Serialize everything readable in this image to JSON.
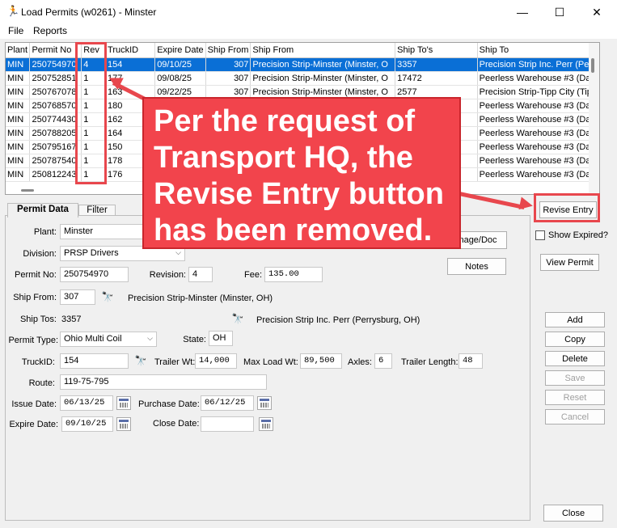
{
  "window": {
    "title": "Load Permits (w0261) - Minster",
    "minimize": "—",
    "maximize": "☐",
    "close": "✕"
  },
  "menu": [
    "File",
    "Reports"
  ],
  "grid": {
    "columns": [
      "Plant",
      "Permit No",
      "Rev",
      "TruckID",
      "Expire Date",
      "Ship From",
      "Ship From",
      "Ship To's",
      "Ship To"
    ],
    "rows": [
      [
        "MIN",
        "250754970",
        "4",
        "154",
        "09/10/25",
        "307",
        "Precision Strip-Minster (Minster, O",
        "3357",
        "Precision Strip Inc. Perr (Perr"
      ],
      [
        "MIN",
        "250752851",
        "1",
        "177",
        "09/08/25",
        "307",
        "Precision Strip-Minster (Minster, O",
        "17472",
        "Peerless Warehouse #3 (Day"
      ],
      [
        "MIN",
        "250767078",
        "1",
        "163",
        "09/22/25",
        "307",
        "Precision Strip-Minster (Minster, O",
        "2577",
        "Precision Strip-Tipp City (Tipp"
      ],
      [
        "MIN",
        "250768570",
        "1",
        "180",
        "",
        "",
        "",
        "",
        "Peerless Warehouse #3 (Day"
      ],
      [
        "MIN",
        "250774430",
        "1",
        "162",
        "",
        "",
        "",
        "",
        "Peerless Warehouse #3 (Day"
      ],
      [
        "MIN",
        "250788205",
        "1",
        "164",
        "",
        "",
        "",
        "",
        "Peerless Warehouse #3 (Day"
      ],
      [
        "MIN",
        "250795167",
        "1",
        "150",
        "",
        "",
        "",
        "",
        "Peerless Warehouse #3 (Day"
      ],
      [
        "MIN",
        "250787540",
        "1",
        "178",
        "",
        "",
        "",
        "",
        "Peerless Warehouse #3 (Day"
      ],
      [
        "MIN",
        "250812243",
        "1",
        "176",
        "",
        "",
        "",
        "",
        "Peerless Warehouse #3 (Day"
      ]
    ]
  },
  "tabs": [
    "Permit Data",
    "Filter"
  ],
  "form": {
    "plant_label": "Plant:",
    "plant": "Minster",
    "division_label": "Division:",
    "division": "PRSP Drivers",
    "permit_no_label": "Permit No:",
    "permit_no": "250754970",
    "revision_label": "Revision:",
    "revision": "4",
    "fee_label": "Fee:",
    "fee": "135.00",
    "ship_from_label": "Ship From:",
    "ship_from": "307",
    "ship_from_name": "Precision Strip-Minster (Minster, OH)",
    "ship_tos_label": "Ship Tos:",
    "ship_tos": "3357",
    "ship_to_name": "Precision Strip Inc. Perr (Perrysburg, OH)",
    "permit_type_label": "Permit Type:",
    "permit_type": "Ohio Multi Coil",
    "state_label": "State:",
    "state": "OH",
    "truck_label": "TruckID:",
    "truck": "154",
    "trailer_wt_label": "Trailer Wt:",
    "trailer_wt": "14,000",
    "max_load_label": "Max Load Wt:",
    "max_load": "89,500",
    "axles_label": "Axles:",
    "axles": "6",
    "trailer_len_label": "Trailer Length:",
    "trailer_len": "48",
    "route_label": "Route:",
    "route": "119-75-795",
    "issue_label": "Issue Date:",
    "issue": "06/13/25",
    "purchase_label": "Purchase Date:",
    "purchase": "06/12/25",
    "expire_label": "Expire Date:",
    "expire": "09/10/25",
    "close_date_label": "Close Date:",
    "close_date": ""
  },
  "buttons": {
    "image_doc": "nage/Doc",
    "notes": "Notes",
    "revise_entry": "Revise Entry",
    "show_expired": "Show Expired?",
    "view_permit": "View Permit",
    "add": "Add",
    "copy": "Copy",
    "delete": "Delete",
    "save": "Save",
    "reset": "Reset",
    "cancel": "Cancel",
    "close": "Close"
  },
  "callout": {
    "lines": [
      "Per the request of",
      "Transport HQ, the",
      "Revise Entry button",
      "has been removed."
    ]
  },
  "colors": {
    "selection": "#0a6fd6",
    "annotation": "#f2444c"
  }
}
